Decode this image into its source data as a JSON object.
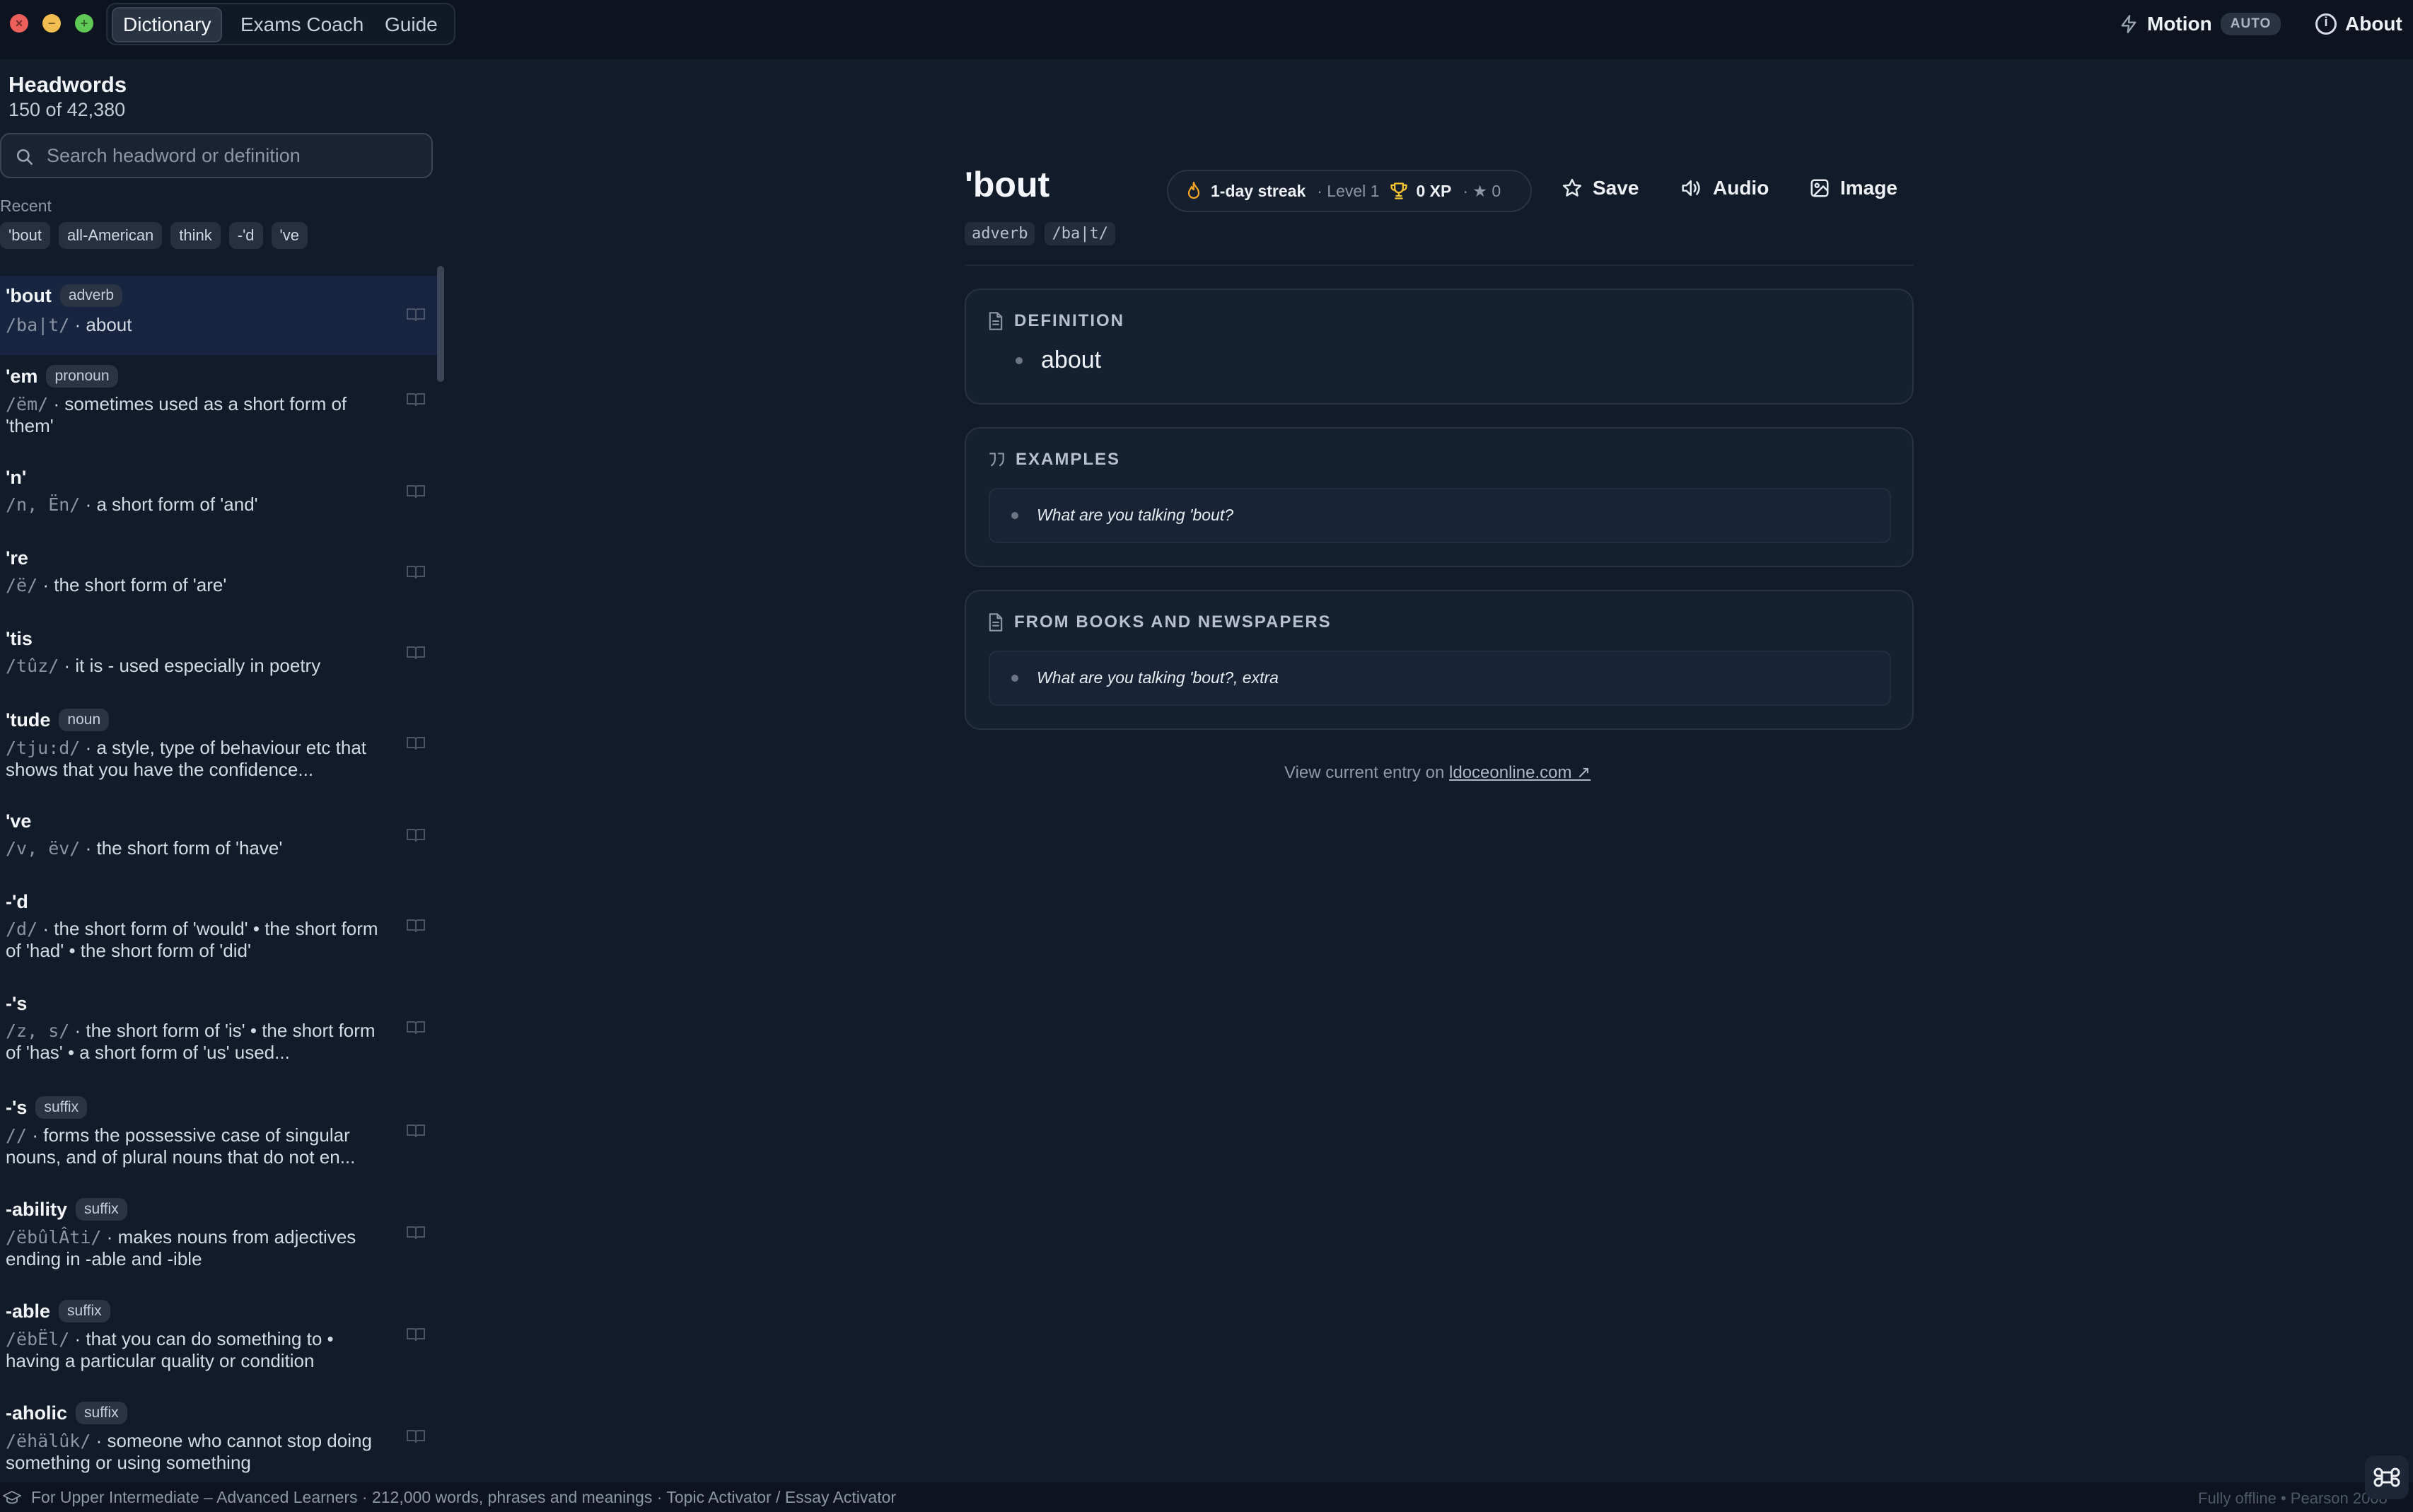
{
  "window": {
    "tabs": [
      {
        "label": "Dictionary",
        "active": true
      },
      {
        "label": "Exams Coach",
        "active": false
      },
      {
        "label": "Guide",
        "active": false
      }
    ],
    "motion_label": "Motion",
    "motion_badge": "AUTO",
    "about_label": "About"
  },
  "sidebar": {
    "title": "Headwords",
    "count": "150 of 42,380",
    "search_placeholder": "Search headword or definition",
    "recent_label": "Recent",
    "recent": [
      "'bout",
      "all-American",
      "think",
      "-'d",
      "'ve"
    ],
    "items": [
      {
        "word": "'bout",
        "pos": "adverb",
        "pron": "/ba|t/",
        "def": " · about"
      },
      {
        "word": "'em",
        "pos": "pronoun",
        "pron": "/ëm/",
        "def": " · sometimes used as a short form of 'them'"
      },
      {
        "word": "'n'",
        "pos": "",
        "pron": "/n, Ën/",
        "def": " · a short form of 'and'"
      },
      {
        "word": "'re",
        "pos": "",
        "pron": "/ë/",
        "def": " · the short form of 'are'"
      },
      {
        "word": "'tis",
        "pos": "",
        "pron": "/tûz/",
        "def": " · it is - used especially in poetry"
      },
      {
        "word": "'tude",
        "pos": "noun",
        "pron": "/tju:d/",
        "def": " · a style, type of behaviour etc that shows that you have the confidence..."
      },
      {
        "word": "'ve",
        "pos": "",
        "pron": "/v, ëv/",
        "def": " · the short form of 'have'"
      },
      {
        "word": "-'d",
        "pos": "",
        "pron": "/d/",
        "def": " · the short form of 'would' • the short form of 'had' • the short form of 'did'"
      },
      {
        "word": "-'s",
        "pos": "",
        "pron": "/z, s/",
        "def": " · the short form of 'is' • the short form of 'has' • a short form of 'us' used..."
      },
      {
        "word": "-'s",
        "pos": "suffix",
        "pron": "//",
        "def": " · forms the possessive case of singular nouns, and of plural nouns that do not en..."
      },
      {
        "word": "-ability",
        "pos": "suffix",
        "pron": "/ëbûlÂti/",
        "def": " · makes nouns from adjectives ending in -able and -ible"
      },
      {
        "word": "-able",
        "pos": "suffix",
        "pron": "/ëbËl/",
        "def": " · that you can do something to • having a particular quality or condition"
      },
      {
        "word": "-aholic",
        "pos": "suffix",
        "pron": "/ëhälûk/",
        "def": " · someone who cannot stop doing something or using something"
      }
    ]
  },
  "entry": {
    "word": "'bout",
    "pos": "adverb",
    "pron": "/ba|t/",
    "streak": {
      "days": "1-day streak",
      "level": "· Level 1",
      "xp": "0 XP",
      "stars": "· ★ 0"
    },
    "actions": {
      "save": "Save",
      "audio": "Audio",
      "image": "Image"
    },
    "definition_heading": "DEFINITION",
    "definition": "about",
    "examples_heading": "EXAMPLES",
    "example": "What are you talking 'bout?",
    "books_heading": "FROM BOOKS AND NEWSPAPERS",
    "book_example": "What are you talking 'bout?, extra",
    "view_prefix": "View current entry on ",
    "view_link": "ldoceonline.com ↗"
  },
  "footer": {
    "info": "For Upper Intermediate – Advanced Learners · 212,000 words, phrases and meanings · Topic Activator / Essay Activator",
    "status": "Fully offline • Pearson 2008"
  },
  "colors": {
    "background": "#121b29",
    "sidebar_selected": "#172540",
    "accent_streak": "#f5a524"
  }
}
